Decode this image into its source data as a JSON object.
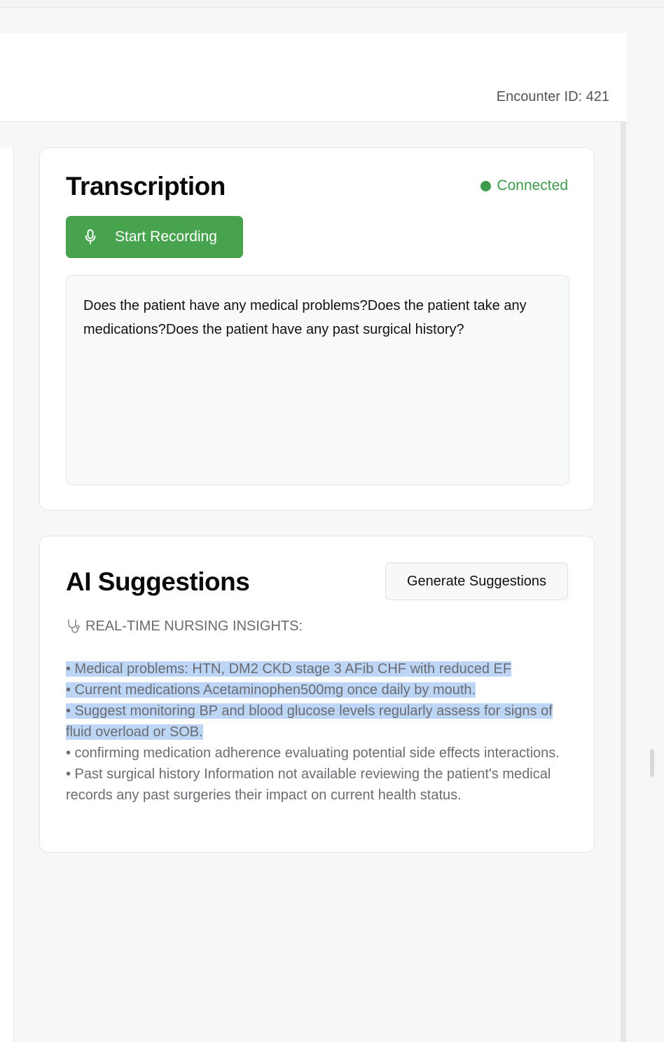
{
  "header": {
    "encounter_label": "Encounter ID: 421"
  },
  "transcription": {
    "title": "Transcription",
    "status": "Connected",
    "record_button": "Start Recording",
    "text": "Does the patient have any medical problems?Does the patient take any medications?Does the patient have any past surgical history?"
  },
  "ai_suggestions": {
    "title": "AI Suggestions",
    "generate_button": "Generate Suggestions",
    "insights_heading": "REAL-TIME NURSING INSIGHTS:",
    "lines": [
      "• Medical problems: HTN, DM2 CKD stage 3 AFib CHF with reduced EF",
      "• Current medications Acetaminophen500mg once daily by mouth.",
      "• Suggest monitoring BP and blood glucose levels regularly assess for signs of fluid overload or SOB.",
      "• confirming medication adherence evaluating potential side effects interactions.",
      "• Past surgical history Information not available reviewing the patient's medical records any past surgeries their impact on current health status."
    ]
  },
  "colors": {
    "accent_green": "#48a34f",
    "status_green": "#3d9a4a",
    "selection_blue": "#bdd6f6"
  },
  "icons": {
    "record": "microphone-icon",
    "insights": "stethoscope-icon",
    "status": "status-dot"
  }
}
